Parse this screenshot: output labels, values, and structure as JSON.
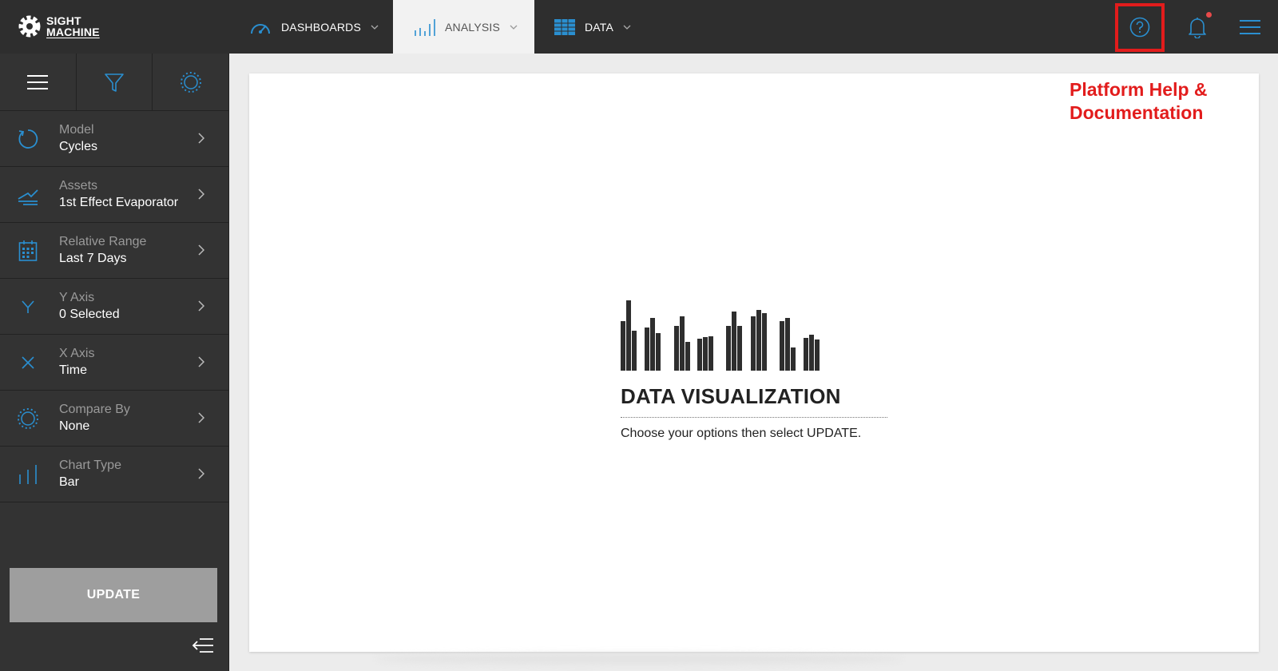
{
  "brand": {
    "line1": "SIGHT",
    "line2": "MACHINE"
  },
  "nav": {
    "tabs": [
      {
        "label": "DASHBOARDS",
        "icon": "gauge-icon"
      },
      {
        "label": "ANALYSIS",
        "icon": "bar-chart-icon",
        "active": true
      },
      {
        "label": "DATA",
        "icon": "table-icon"
      }
    ]
  },
  "header_icons": {
    "help": "help-icon",
    "notifications": "bell-icon",
    "menu": "hamburger-menu-icon"
  },
  "sidebar": {
    "options": [
      {
        "label": "Model",
        "value": "Cycles",
        "icon": "refresh-icon"
      },
      {
        "label": "Assets",
        "value": "1st Effect Evaporator",
        "icon": "assets-icon"
      },
      {
        "label": "Relative Range",
        "value": "Last 7 Days",
        "icon": "calendar-icon"
      },
      {
        "label": "Y Axis",
        "value": "0 Selected",
        "icon": "y-axis-icon"
      },
      {
        "label": "X Axis",
        "value": "Time",
        "icon": "x-axis-icon"
      },
      {
        "label": "Compare By",
        "value": "None",
        "icon": "compare-icon"
      },
      {
        "label": "Chart Type",
        "value": "Bar",
        "icon": "chart-type-icon"
      }
    ],
    "update_label": "UPDATE"
  },
  "main": {
    "title": "DATA VISUALIZATION",
    "subtitle": "Choose your options then select UPDATE.",
    "annotation": {
      "line1": "Platform Help &",
      "line2": "Documentation"
    }
  },
  "colors": {
    "topbar": "#2e2e2e",
    "sidebar": "#333333",
    "accent": "#2a8fd0",
    "annotation": "#e21c1c",
    "update_button": "#9e9e9e"
  }
}
